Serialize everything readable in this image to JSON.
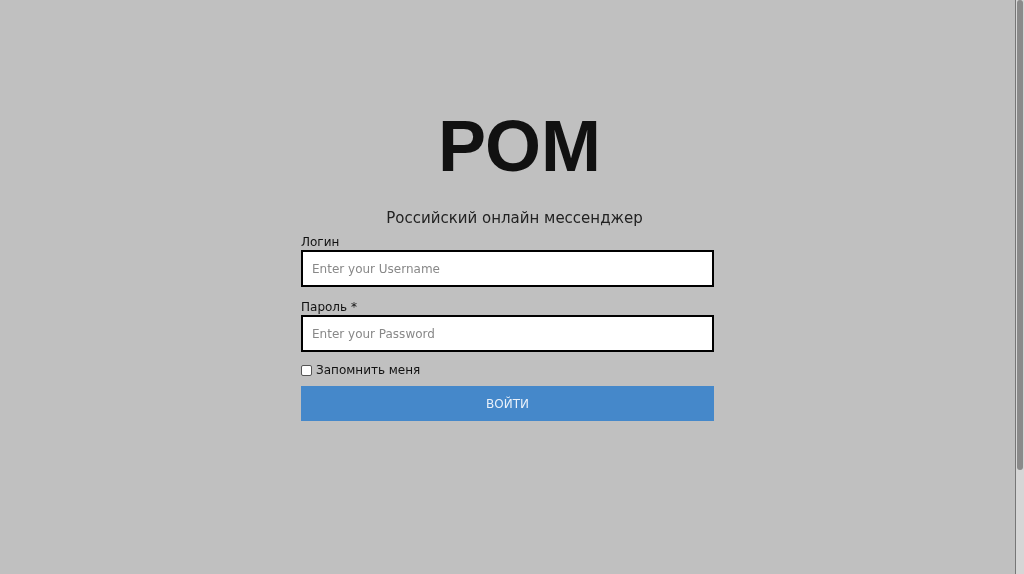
{
  "title": "РОМ",
  "subtitle": "Российский онлайн мессенджер",
  "fields": [
    {
      "label": "Логин",
      "placeholder": "Enter your Username"
    },
    {
      "label": "Пароль *",
      "placeholder": "Enter your Password"
    }
  ],
  "remember": {
    "label": "Запомнить меня",
    "checked": false
  },
  "submit": "ВОЙТИ"
}
